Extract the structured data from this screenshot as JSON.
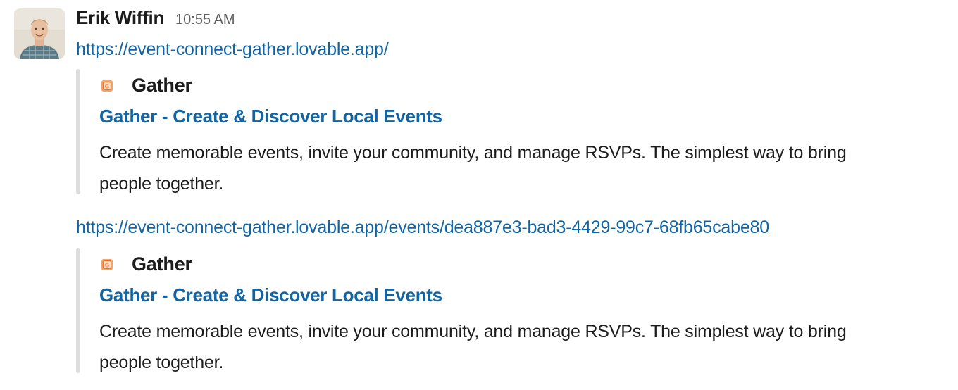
{
  "message": {
    "sender": "Erik Wiffin",
    "timestamp": "10:55 AM",
    "avatar": "avatar-photo"
  },
  "links": [
    {
      "url": "https://event-connect-gather.lovable.app/",
      "preview": {
        "site_icon": "gather-favicon",
        "site_name": "Gather",
        "title": "Gather - Create & Discover Local Events",
        "description": "Create memorable events, invite your community, and manage RSVPs. The simplest way to bring people together."
      }
    },
    {
      "url": "https://event-connect-gather.lovable.app/events/dea887e3-bad3-4429-99c7-68fb65cabe80",
      "preview": {
        "site_icon": "gather-favicon",
        "site_name": "Gather",
        "title": "Gather - Create & Discover Local Events",
        "description": "Create memorable events, invite your community, and manage RSVPs. The simplest way to bring people together."
      }
    }
  ],
  "colors": {
    "link": "#1264a3",
    "text": "#1d1c1d",
    "muted": "#616061",
    "unfurl_bar": "#dddddd",
    "favicon": "#e8732c"
  }
}
